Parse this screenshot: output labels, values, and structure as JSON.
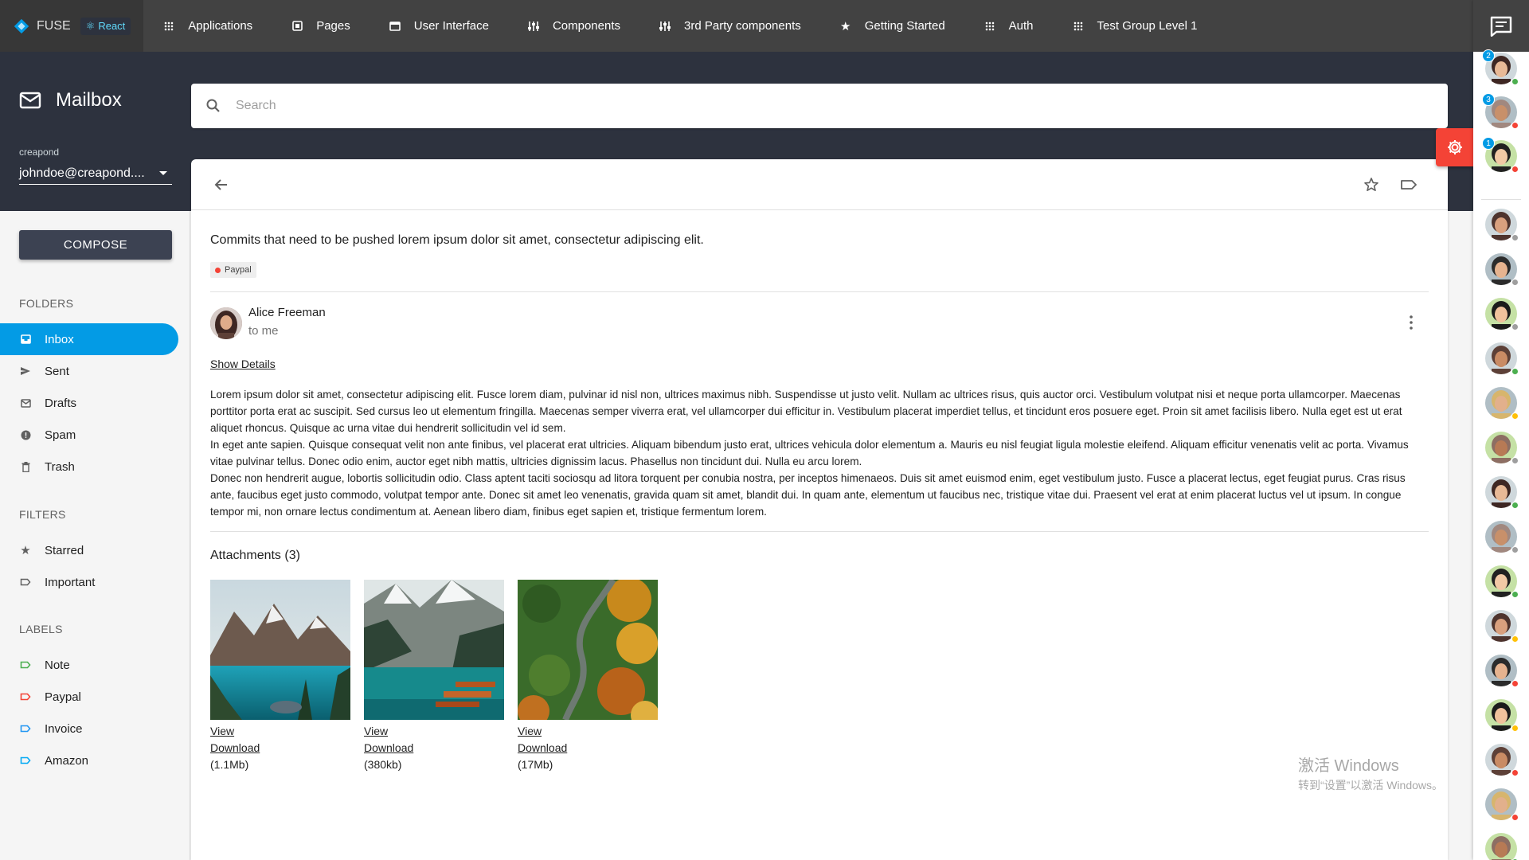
{
  "brand": {
    "name": "FUSE",
    "badge": "React",
    "logo_color": "#039be5",
    "badge_color": "#61dafb"
  },
  "nav": [
    {
      "label": "Applications",
      "icon": "apps-icon"
    },
    {
      "label": "Pages",
      "icon": "pages-icon"
    },
    {
      "label": "User Interface",
      "icon": "web-icon"
    },
    {
      "label": "Components",
      "icon": "tune-icon"
    },
    {
      "label": "3rd Party components",
      "icon": "tune-icon"
    },
    {
      "label": "Getting Started",
      "icon": "star-icon"
    },
    {
      "label": "Auth",
      "icon": "apps-icon"
    },
    {
      "label": "Test Group Level 1",
      "icon": "apps-icon"
    }
  ],
  "mailbox": {
    "title": "Mailbox",
    "account_label": "creapond",
    "account_value": "johndoe@creapond...."
  },
  "search": {
    "placeholder": "Search"
  },
  "sidebar": {
    "compose": "COMPOSE",
    "folders_title": "FOLDERS",
    "folders": [
      {
        "label": "Inbox",
        "icon": "inbox-icon",
        "active": true
      },
      {
        "label": "Sent",
        "icon": "send-icon"
      },
      {
        "label": "Drafts",
        "icon": "drafts-icon"
      },
      {
        "label": "Spam",
        "icon": "info-icon"
      },
      {
        "label": "Trash",
        "icon": "delete-icon"
      }
    ],
    "filters_title": "FILTERS",
    "filters": [
      {
        "label": "Starred",
        "icon": "star-icon"
      },
      {
        "label": "Important",
        "icon": "label-icon"
      }
    ],
    "labels_title": "LABELS",
    "labels": [
      {
        "label": "Note",
        "color": "#4caf50"
      },
      {
        "label": "Paypal",
        "color": "#f44336"
      },
      {
        "label": "Invoice",
        "color": "#2196f3"
      },
      {
        "label": "Amazon",
        "color": "#03a9f4"
      }
    ],
    "active_color": "#039be5"
  },
  "mail": {
    "subject": "Commits that need to be pushed lorem ipsum dolor sit amet, consectetur adipiscing elit.",
    "tag": {
      "label": "Paypal",
      "color": "#f44336"
    },
    "sender": "Alice Freeman",
    "to": "to me",
    "show_details": "Show Details",
    "body": [
      "Lorem ipsum dolor sit amet, consectetur adipiscing elit. Fusce lorem diam, pulvinar id nisl non, ultrices maximus nibh. Suspendisse ut justo velit. Nullam ac ultrices risus, quis auctor orci. Vestibulum volutpat nisi et neque porta ullamcorper. Maecenas porttitor porta erat ac suscipit. Sed cursus leo ut elementum fringilla. Maecenas semper viverra erat, vel ullamcorper dui efficitur in. Vestibulum placerat imperdiet tellus, et tincidunt eros posuere eget. Proin sit amet facilisis libero. Nulla eget est ut erat aliquet rhoncus. Quisque ac urna vitae dui hendrerit sollicitudin vel id sem.",
      "In eget ante sapien. Quisque consequat velit non ante finibus, vel placerat erat ultricies. Aliquam bibendum justo erat, ultrices vehicula dolor elementum a. Mauris eu nisl feugiat ligula molestie eleifend. Aliquam efficitur venenatis velit ac porta. Vivamus vitae pulvinar tellus. Donec odio enim, auctor eget nibh mattis, ultricies dignissim lacus. Phasellus non tincidunt dui. Nulla eu arcu lorem.",
      "Donec non hendrerit augue, lobortis sollicitudin odio. Class aptent taciti sociosqu ad litora torquent per conubia nostra, per inceptos himenaeos. Duis sit amet euismod enim, eget vestibulum justo. Fusce a placerat lectus, eget feugiat purus. Cras risus ante, faucibus eget justo commodo, volutpat tempor ante. Donec sit amet leo venenatis, gravida quam sit amet, blandit dui. In quam ante, elementum ut faucibus nec, tristique vitae dui. Praesent vel erat at enim placerat luctus vel ut ipsum. In congue tempor mi, non ornare lectus condimentum at. Aenean libero diam, finibus eget sapien et, tristique fermentum lorem."
    ],
    "attachments_title": "Attachments (3)",
    "attachments": [
      {
        "view": "View",
        "download": "Download",
        "size": "(1.1Mb)"
      },
      {
        "view": "View",
        "download": "Download",
        "size": "(380kb)"
      },
      {
        "view": "View",
        "download": "Download",
        "size": "(17Mb)"
      }
    ]
  },
  "watermark": {
    "line1": "激活 Windows",
    "line2": "转到“设置”以激活 Windows。"
  },
  "contacts": [
    {
      "badge": "2",
      "status": "#4caf50"
    },
    {
      "badge": "3",
      "status": "#f44336"
    },
    {
      "badge": "1",
      "status": "#f44336"
    },
    {
      "status": "#9e9e9e"
    },
    {
      "status": "#9e9e9e"
    },
    {
      "status": "#9e9e9e"
    },
    {
      "status": "#4caf50"
    },
    {
      "status": "#ffc107"
    },
    {
      "status": "#9e9e9e"
    },
    {
      "status": "#4caf50"
    },
    {
      "status": "#9e9e9e"
    },
    {
      "status": "#4caf50"
    },
    {
      "status": "#ffc107"
    },
    {
      "status": "#f44336"
    },
    {
      "status": "#ffc107"
    },
    {
      "status": "#f44336"
    },
    {
      "status": "#f44336"
    },
    {
      "status": "#4caf50"
    }
  ]
}
